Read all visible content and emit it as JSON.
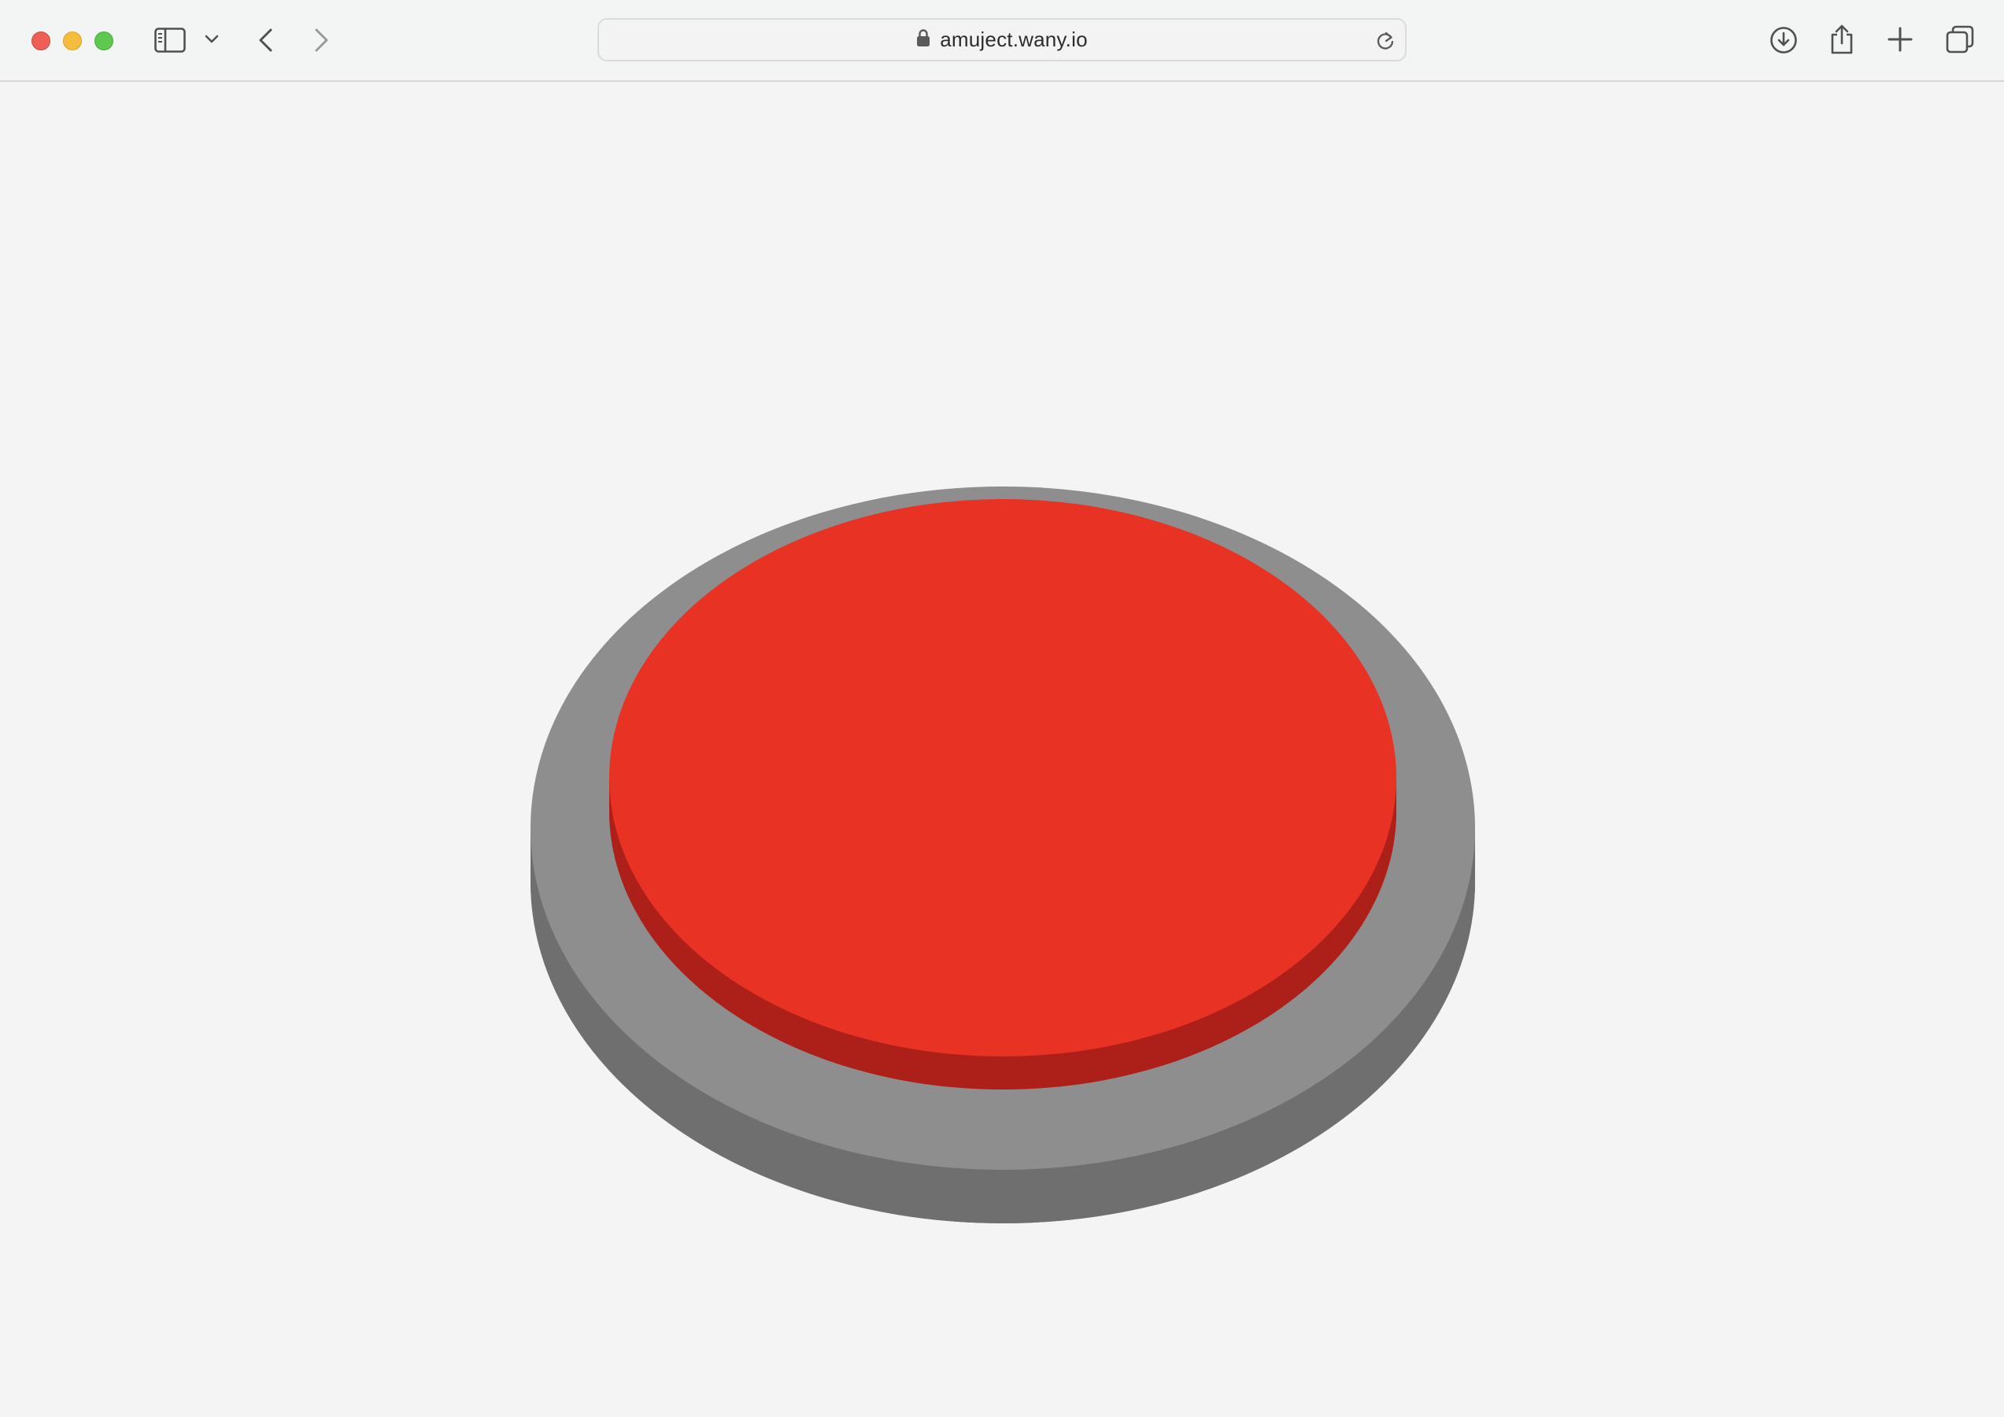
{
  "browser": {
    "url": "amuject.wany.io",
    "icons": {
      "sidebar": "sidebar-icon",
      "chevron": "chevron-down-icon",
      "back": "back-arrow-icon",
      "forward": "forward-arrow-icon",
      "lock": "lock-icon",
      "reload": "reload-icon",
      "download": "download-icon",
      "share": "share-icon",
      "new_tab": "plus-icon",
      "tabs": "tab-overview-icon"
    }
  },
  "page": {
    "big_red_button": {
      "top_color": "#e83224",
      "side_color": "#ad2019",
      "base_top_color": "#8e8e8e",
      "base_side_color": "#6f6f6f",
      "background": "#f4f4f4"
    }
  }
}
